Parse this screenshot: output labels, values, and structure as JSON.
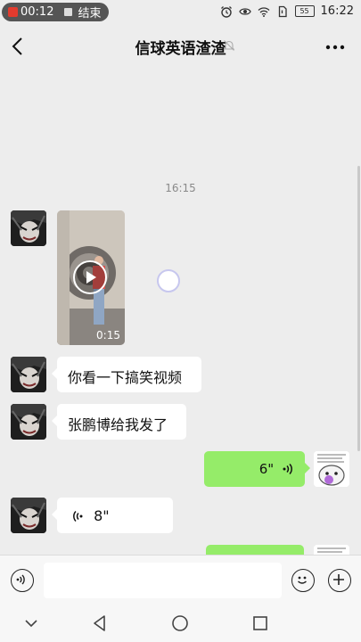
{
  "status_bar": {
    "record_time": "00:12",
    "end_label": "结束",
    "battery": "55",
    "clock": "16:22"
  },
  "header": {
    "title": "信球英语渣渣"
  },
  "chat": {
    "timestamp": "16:15",
    "video_duration": "0:15",
    "messages": [
      {
        "text": "你看一下搞笑视频"
      },
      {
        "text": "张鹏博给我发了"
      }
    ],
    "voice_out": {
      "duration": "6\""
    },
    "voice_in": {
      "duration": "8\""
    }
  },
  "input": {
    "value": ""
  },
  "colors": {
    "outgoing_bubble": "#95ec69",
    "incoming_bubble": "#ffffff",
    "background": "#ededed"
  }
}
